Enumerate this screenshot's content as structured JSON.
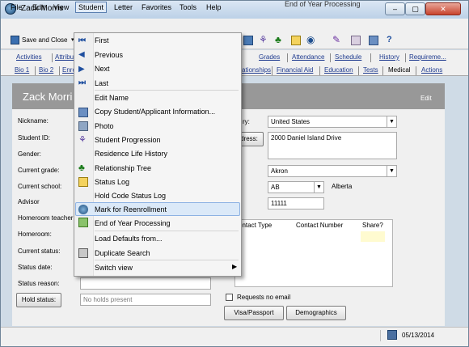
{
  "window": {
    "title": "Zack Morris",
    "background_title": "End of Year Processing",
    "minimize": "–",
    "maximize": "▢",
    "close": "✕"
  },
  "menubar": [
    "File",
    "Edit",
    "View",
    "Student",
    "Letter",
    "Favorites",
    "Tools",
    "Help"
  ],
  "toolbar": {
    "save_close": "Save and Close",
    "help_label": "?"
  },
  "tabs_row1": [
    "Activities",
    "Attribu",
    "Grades",
    "Attendance",
    "Schedule",
    "History",
    "Requireme..."
  ],
  "tabs_row2": [
    "Bio 1",
    "Bio 2",
    "Enro",
    "ationships",
    "Financial Aid",
    "Education",
    "Tests",
    "Medical",
    "Actions"
  ],
  "banner": {
    "name": "Zack Morri",
    "edit": "Edit"
  },
  "form": {
    "labels": [
      "Nickname:",
      "Student ID:",
      "Gender:",
      "Current grade:",
      "Current school:",
      "Advisor",
      "Homeroom teacher",
      "Homeroom:",
      "Current status:",
      "Status date:",
      "Status reason:"
    ],
    "hold_status_btn": "Hold status:",
    "holds_placeholder": "No holds present",
    "country_label": "ry:",
    "country_value": "United States",
    "address_btn": "dress:",
    "address_value": "2000 Daniel Island Drive",
    "city_value": "Akron",
    "state_value": "AB",
    "province_text": "Alberta",
    "zip_value": "11111",
    "contact_headers": [
      "ontact Type",
      "Contact Number",
      "Share?"
    ],
    "requests_no_email": "Requests no email",
    "visa_btn": "Visa/Passport",
    "demographics_btn": "Demographics"
  },
  "statusbar": {
    "date": "05/13/2014"
  },
  "student_menu": [
    {
      "label": "First",
      "icon": "first-icon"
    },
    {
      "label": "Previous",
      "icon": "previous-icon"
    },
    {
      "label": "Next",
      "icon": "next-icon"
    },
    {
      "label": "Last",
      "icon": "last-icon"
    },
    {
      "label": "Edit Name",
      "icon": ""
    },
    {
      "label": "Copy Student/Applicant Information...",
      "icon": "copy-icon"
    },
    {
      "label": "Photo",
      "icon": "photo-icon"
    },
    {
      "label": "Student Progression",
      "icon": "progression-icon"
    },
    {
      "label": "Residence Life History",
      "icon": ""
    },
    {
      "label": "Relationship Tree",
      "icon": "tree-icon"
    },
    {
      "label": "Status Log",
      "icon": "status-log-icon"
    },
    {
      "label": "Hold Code Status Log",
      "icon": ""
    },
    {
      "label": "Mark for Reenrollment",
      "icon": "reenrollment-icon"
    },
    {
      "label": "End of Year Processing",
      "icon": "end-of-year-icon"
    },
    {
      "label": "Load Defaults from...",
      "icon": ""
    },
    {
      "label": "Duplicate Search",
      "icon": "duplicate-search-icon"
    },
    {
      "label": "Switch view",
      "icon": ""
    }
  ],
  "colors": {
    "highlight": "#dbe9f8",
    "banner": "#989898",
    "link": "#1f3b8f"
  }
}
